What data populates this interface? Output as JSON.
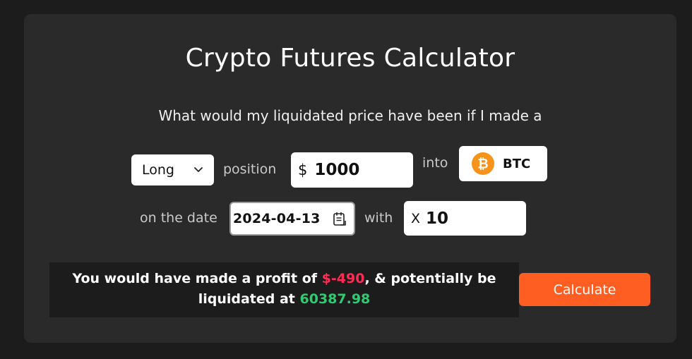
{
  "title": "Crypto Futures Calculator",
  "question": "What would my liquidated price have been if I made a",
  "form": {
    "direction": {
      "selected": "Long"
    },
    "position_label": "position",
    "amount": {
      "prefix": "$",
      "value": "1000"
    },
    "into_label": "into",
    "coin": {
      "symbol": "BTC",
      "icon_glyph": "₿",
      "icon_color": "#f7931a"
    },
    "date_label": "on the date",
    "date": {
      "value": "2024-04-13"
    },
    "with_label": "with",
    "leverage": {
      "prefix": "X",
      "value": "10"
    }
  },
  "result": {
    "part1": "You would have made a profit of ",
    "profit": "$-490",
    "part2": ", & potentially be liquidated at ",
    "liquidation_price": "60387.98",
    "profit_color": "#ff2d55",
    "liquidation_color": "#2ecc71"
  },
  "calculate_label": "Calculate",
  "colors": {
    "accent": "#ff5e23",
    "background": "#1c1c1c",
    "card": "#2a2a2a"
  }
}
